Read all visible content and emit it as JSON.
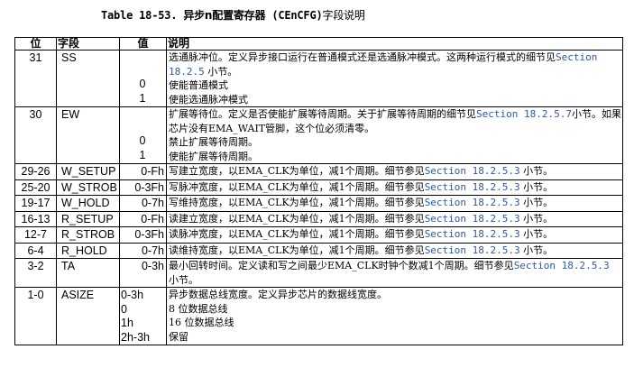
{
  "caption": {
    "label": "Table 18-53.",
    "title_cn": "异步n配置寄存器",
    "reg": "(CEnCFG)",
    "tail": "字段说明"
  },
  "headers": {
    "bit": "位",
    "field": "字段",
    "value": "值",
    "desc": "说明"
  },
  "rows": [
    {
      "bit": "31",
      "field": "SS",
      "values": [
        "0",
        "1"
      ],
      "desc": [
        "选通脉冲位。定义异步接口运行在普通模式还是选通脉冲模式。这两种运行模式的细节见",
        "Section 18.2.5",
        "小节。",
        "使能普通模式",
        "使能选通脉冲模式"
      ]
    },
    {
      "bit": "30",
      "field": "EW",
      "values": [
        "0",
        "1"
      ],
      "desc": [
        "扩展等待位。定义是否使能扩展等待周期。关于扩展等待周期的细节见",
        "Section 18.2.5.7",
        "小节。如果芯片没有EMA_WAIT管脚，这个位必须清零。",
        "禁止扩展等待周期。",
        "使能扩展等待周期。"
      ]
    },
    {
      "bit": "29-26",
      "field": "W_SETUP",
      "value": "0-Fh",
      "desc": [
        "写建立宽度，以EMA_CLK为单位，减1个周期。细节参见",
        "Section 18.2.5.3",
        "小节。"
      ]
    },
    {
      "bit": "25-20",
      "field": "W_STROB",
      "value": "0-3Fh",
      "desc": [
        "写脉冲宽度，以EMA_CLK为单位，减1个周期。细节参见",
        "Section 18.2.5.3",
        "小节。"
      ]
    },
    {
      "bit": "19-17",
      "field": "W_HOLD",
      "value": "0-7h",
      "desc": [
        "写维持宽度，以EMA_CLK为单位，减1个周期。细节参见",
        "Section 18.2.5.3",
        "小节。"
      ]
    },
    {
      "bit": "16-13",
      "field": "R_SETUP",
      "value": "0-Fh",
      "desc": [
        "读建立宽度，以EMA_CLK为单位，减1个周期。细节参见",
        "Section 18.2.5.3",
        "小节。"
      ]
    },
    {
      "bit": "12-7",
      "field": "R_STROB",
      "value": "0-3Fh",
      "desc": [
        "读脉冲宽度，以EMA_CLK为单位，减1个周期。细节参见",
        "Section 18.2.5.3",
        "小节。"
      ]
    },
    {
      "bit": "6-4",
      "field": "R_HOLD",
      "value": "0-7h",
      "desc": [
        "读维持宽度，以EMA_CLK为单位，减1个周期。细节参见",
        "Section 18.2.5.3",
        "小节。"
      ]
    },
    {
      "bit": "3-2",
      "field": "TA",
      "value": "0-3h",
      "desc": [
        "最小回转时间。定义读和写之间最少EMA_CLK时钟个数减1个周期。细节参见",
        "Section 18.2.5.3",
        "小节。"
      ]
    },
    {
      "bit": "1-0",
      "field": "ASIZE",
      "values": [
        "0-3h",
        "0",
        "1h",
        "2h-3h"
      ],
      "desc": [
        "异步数据总线宽度。定义异步芯片的数据线宽度。",
        "8 位数据总线",
        "16 位数据总线",
        "保留"
      ]
    }
  ]
}
